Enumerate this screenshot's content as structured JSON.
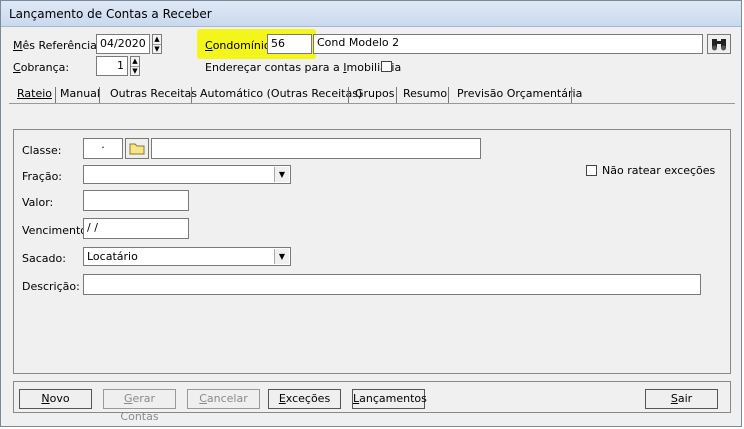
{
  "window": {
    "title": "Lançamento de Contas a Receber"
  },
  "header": {
    "mes_ref_label": "Mês Referência:",
    "mes_ref_value": "04/2020",
    "cobranca_label": "Cobrança:",
    "cobranca_value": "1",
    "condominio_label": "Condomínio:",
    "condominio_code": "56",
    "condominio_name": "Cond Modelo 2",
    "enderecar_label": "Endereçar contas para a Imobiliária"
  },
  "tabs": [
    "Rateio",
    "Manual",
    "Outras Receitas",
    "Automático (Outras Receitas)",
    "Grupos",
    "Resumo",
    "Previsão Orçamentária"
  ],
  "form": {
    "classe_label": "Classe:",
    "classe_value": "·",
    "fracao_label": "Fração:",
    "fracao_value": "",
    "valor_label": "Valor:",
    "vencimento_label": "Vencimento:",
    "vencimento_value": " / /",
    "sacado_label": "Sacado:",
    "sacado_value": "Locatário",
    "descricao_label": "Descrição:",
    "nao_ratear_label": "Não ratear exceções"
  },
  "buttons": {
    "novo": "Novo",
    "gerar": "Gerar Contas",
    "cancelar": "Cancelar",
    "excecoes": "Exceções",
    "lancamentos": "Lançamentos",
    "sair": "Sair"
  },
  "colors": {
    "highlight": "#f4f51a",
    "title_bg": "#dfe9f5"
  }
}
